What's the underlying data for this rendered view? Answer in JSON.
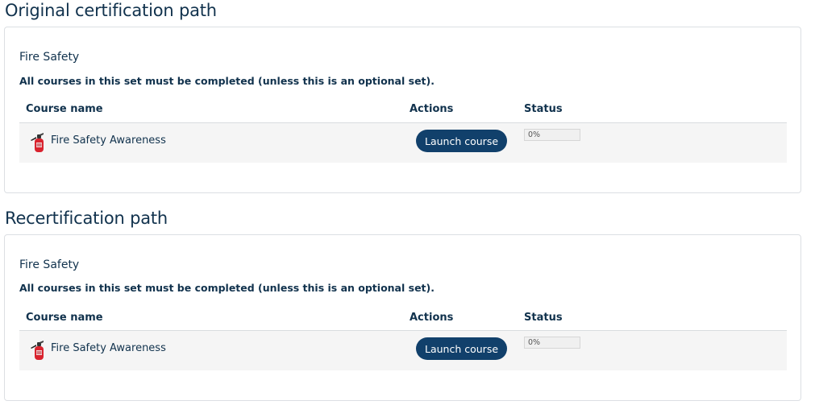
{
  "sections": [
    {
      "title": "Original certification path",
      "set_name": "Fire Safety",
      "set_description": "All courses in this set must be completed (unless this is an optional set).",
      "columns": {
        "course_name": "Course name",
        "actions": "Actions",
        "status": "Status"
      },
      "courses": [
        {
          "icon": "fire-extinguisher-icon",
          "name": "Fire Safety Awareness",
          "action_label": "Launch course",
          "progress_text": "0%",
          "progress": 0
        }
      ]
    },
    {
      "title": "Recertification path",
      "set_name": "Fire Safety",
      "set_description": "All courses in this set must be completed (unless this is an optional set).",
      "columns": {
        "course_name": "Course name",
        "actions": "Actions",
        "status": "Status"
      },
      "courses": [
        {
          "icon": "fire-extinguisher-icon",
          "name": "Fire Safety Awareness",
          "action_label": "Launch course",
          "progress_text": "0%",
          "progress": 0
        }
      ]
    }
  ],
  "colors": {
    "heading": "#11324d",
    "button": "#11406b",
    "row_bg": "#f5f5f5",
    "border": "#dcdfe3"
  }
}
